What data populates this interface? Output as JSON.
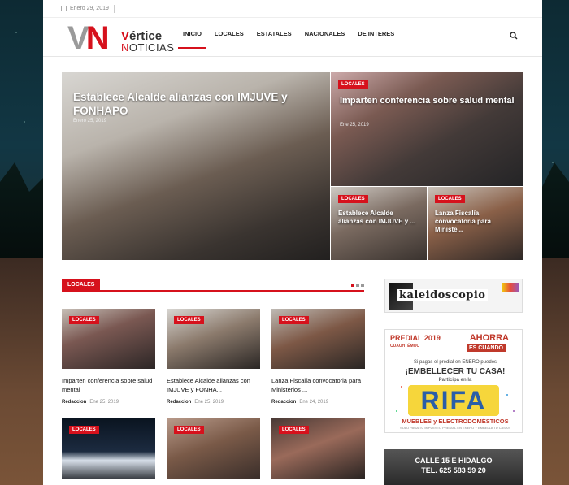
{
  "topbar": {
    "date": "Enero 29, 2019"
  },
  "brand": {
    "mark_v": "V",
    "mark_n": "N",
    "word1_v": "V",
    "word1_rest": "értice",
    "word2_n": "N",
    "word2_rest": "OTICIAS"
  },
  "nav": {
    "items": [
      "INICIO",
      "LOCALES",
      "ESTATALES",
      "NACIONALES",
      "DE INTERES"
    ],
    "active": "INICIO",
    "search_icon": "search-icon"
  },
  "hero": {
    "main": {
      "title": "Establece Alcalde alianzas con IMJUVE y FONHAPO",
      "date": "Enero 25, 2019"
    },
    "right_top": {
      "category": "LOCALES",
      "title": "Imparten conferencia sobre salud mental",
      "date": "Ene 25, 2019"
    },
    "right_bottom_left": {
      "category": "LOCALES",
      "title": "Establece Alcalde alianzas con IMJUVE y ..."
    },
    "right_bottom_right": {
      "category": "LOCALES",
      "title": "Lanza Fiscalía convocatoria para Ministe..."
    }
  },
  "section": {
    "label": "LOCALES",
    "cards": [
      {
        "category": "LOCALES",
        "title": "Imparten conferencia sobre salud mental",
        "author": "Redaccion",
        "date": "Ene 25, 2019"
      },
      {
        "category": "LOCALES",
        "title": "Establece Alcalde alianzas con IMJUVE y FONHA...",
        "author": "Redaccion",
        "date": "Ene 25, 2019"
      },
      {
        "category": "LOCALES",
        "title": "Lanza Fiscalía convocatoria para Ministerios ...",
        "author": "Redaccion",
        "date": "Ene 24, 2019"
      },
      {
        "category": "LOCALES"
      },
      {
        "category": "LOCALES"
      },
      {
        "category": "LOCALES"
      }
    ]
  },
  "sidebar": {
    "ad1": {
      "text": "kaleidoscopio"
    },
    "ad2": {
      "predial": "PREDIAL 2019",
      "ahorra": "AHORRA",
      "es_cuando": "ES CUANDO",
      "org": "CUAUHTÉMOC",
      "line1": "Si pagas el predial en ENERO puedes",
      "embellecer": "¡EMBELLECER TU CASA!",
      "participa": "Participa en la",
      "rifa": "RIFA",
      "muebles": "MUEBLES y ELECTRODOMÉSTICOS",
      "fine": "SOLO PAGA TU IMPUESTO PREDIAL EN ENERO Y EMBELLA TU CASA!!!"
    },
    "ad3": {
      "line1": "CALLE 15 E HIDALGO",
      "line2": "TEL. 625 583 59 20"
    }
  },
  "colors": {
    "accent": "#d6111c",
    "text": "#222222",
    "meta": "#888888"
  }
}
